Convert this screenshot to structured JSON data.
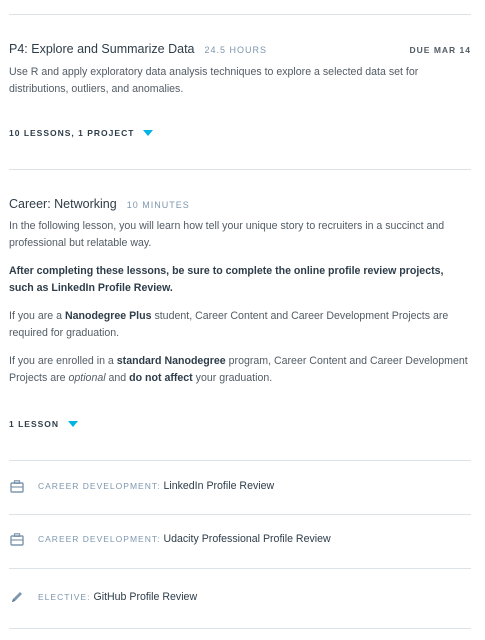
{
  "section1": {
    "title": "P4: Explore and Summarize Data",
    "duration": "24.5 HOURS",
    "due": "DUE MAR 14",
    "description": "Use R and apply exploratory data analysis techniques to explore a selected data set for distributions, outliers, and anomalies.",
    "toggle_label": "10 LESSONS, 1 PROJECT"
  },
  "section2": {
    "title": "Career: Networking",
    "duration": "10 MINUTES",
    "p1": "In the following lesson, you will learn how tell your unique story to recruiters in a succinct and professional but relatable way.",
    "p2": "After completing these lessons, be sure to complete the online profile review projects, such as LinkedIn Profile Review.",
    "p3": {
      "a": "If you are a ",
      "b": "Nanodegree Plus",
      "c": " student, Career Content and Career Development Projects are required for graduation."
    },
    "p4": {
      "a": "If you are enrolled in a ",
      "b": "standard Nanodegree",
      "c": " program, Career Content and Career Development Projects are ",
      "d": "optional",
      "e": " and ",
      "f": "do not affect",
      "g": " your graduation."
    },
    "toggle_label": "1 LESSON"
  },
  "projects": [
    {
      "type": "CAREER DEVELOPMENT:",
      "name": "LinkedIn Profile Review",
      "icon": "briefcase-icon"
    },
    {
      "type": "CAREER DEVELOPMENT:",
      "name": "Udacity Professional Profile Review",
      "icon": "briefcase-icon"
    },
    {
      "type": "ELECTIVE:",
      "name": "GitHub Profile Review",
      "icon": "pencil-icon"
    }
  ],
  "colors": {
    "accent": "#02b3e4",
    "divider": "#dbe2e8",
    "muted": "#7d97ad",
    "text": "#2e3d49"
  }
}
